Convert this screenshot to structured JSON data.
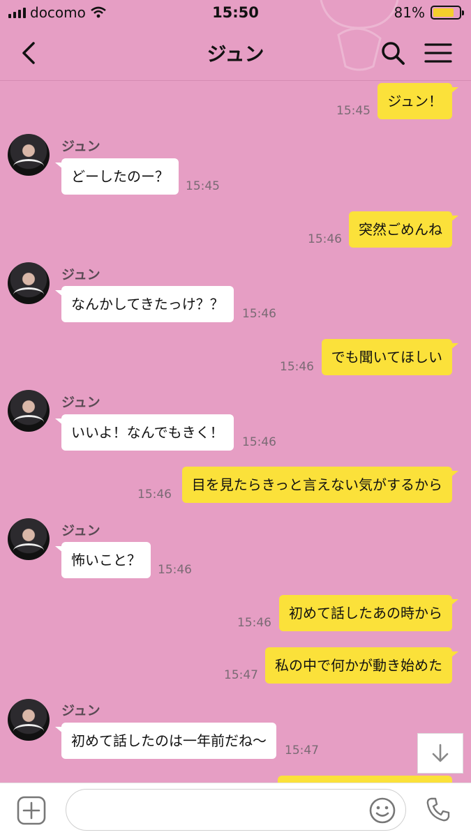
{
  "status_bar": {
    "carrier": "docomo",
    "time": "15:50",
    "battery": "81%"
  },
  "header": {
    "title": "ジュン"
  },
  "colors": {
    "background": "#e69ec4",
    "my_bubble": "#fbe13a",
    "their_bubble": "#ffffff",
    "battery": "#f4cf2c"
  },
  "messages": [
    {
      "from": "me",
      "text": "ジュン！",
      "time": "15:45"
    },
    {
      "from": "them",
      "name": "ジュン",
      "text": "どーしたのー？",
      "time": "15:45"
    },
    {
      "from": "me",
      "text": "突然ごめんね",
      "time": "15:46"
    },
    {
      "from": "them",
      "name": "ジュン",
      "text": "なんかしてきたっけ？？",
      "time": "15:46"
    },
    {
      "from": "me",
      "text": "でも聞いてほしい",
      "time": "15:46"
    },
    {
      "from": "them",
      "name": "ジュン",
      "text": "いいよ！なんでもきく！",
      "time": "15:46"
    },
    {
      "from": "me",
      "text": "目を見たらきっと言えない気がするから",
      "time": "15:46"
    },
    {
      "from": "them",
      "name": "ジュン",
      "text": "怖いこと？",
      "time": "15:46"
    },
    {
      "from": "me",
      "text": "初めて話したあの時から",
      "time": "15:46"
    },
    {
      "from": "me",
      "text": "私の中で何かが動き始めた",
      "time": "15:47"
    },
    {
      "from": "them",
      "name": "ジュン",
      "text": "初めて話したのは一年前だね〜",
      "time": "15:47"
    }
  ],
  "input": {
    "placeholder": ""
  },
  "icons": {
    "back": "chevron-left-icon",
    "search": "search-icon",
    "menu": "hamburger-menu-icon",
    "plus": "plus-icon",
    "emoji": "smiley-icon",
    "call": "phone-icon",
    "scroll": "arrow-down-icon"
  }
}
